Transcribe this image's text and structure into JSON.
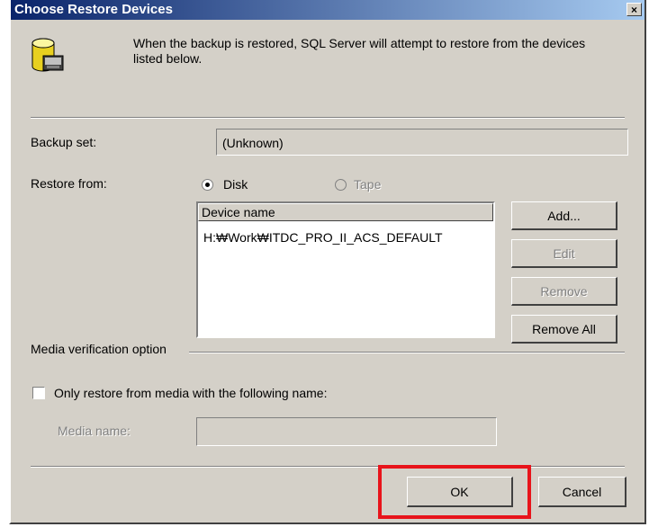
{
  "window": {
    "title": "Choose Restore Devices",
    "close_glyph": "×"
  },
  "message": "When the backup is restored, SQL Server will attempt to restore from the devices listed below.",
  "icon": "database-tape-icon",
  "backup_set": {
    "label": "Backup set:",
    "value": "(Unknown)"
  },
  "restore_from": {
    "label": "Restore from:",
    "options": [
      {
        "label": "Disk",
        "selected": true,
        "enabled": true
      },
      {
        "label": "Tape",
        "selected": false,
        "enabled": false
      }
    ]
  },
  "device_list": {
    "header": "Device name",
    "items": [
      "H:₩Work₩ITDC_PRO_II_ACS_DEFAULT"
    ]
  },
  "device_buttons": {
    "add": "Add...",
    "edit": "Edit",
    "remove": "Remove",
    "remove_all": "Remove All"
  },
  "media_verification": {
    "label": "Media verification option",
    "checkbox_label": "Only restore from media with the following name:",
    "checked": false,
    "media_name_label": "Media name:",
    "media_name_value": ""
  },
  "footer": {
    "ok": "OK",
    "cancel": "Cancel"
  },
  "colors": {
    "titlebar_start": "#0a246a",
    "titlebar_end": "#a6caf0",
    "face": "#d4d0c8",
    "highlight_box": "#e8141b"
  }
}
